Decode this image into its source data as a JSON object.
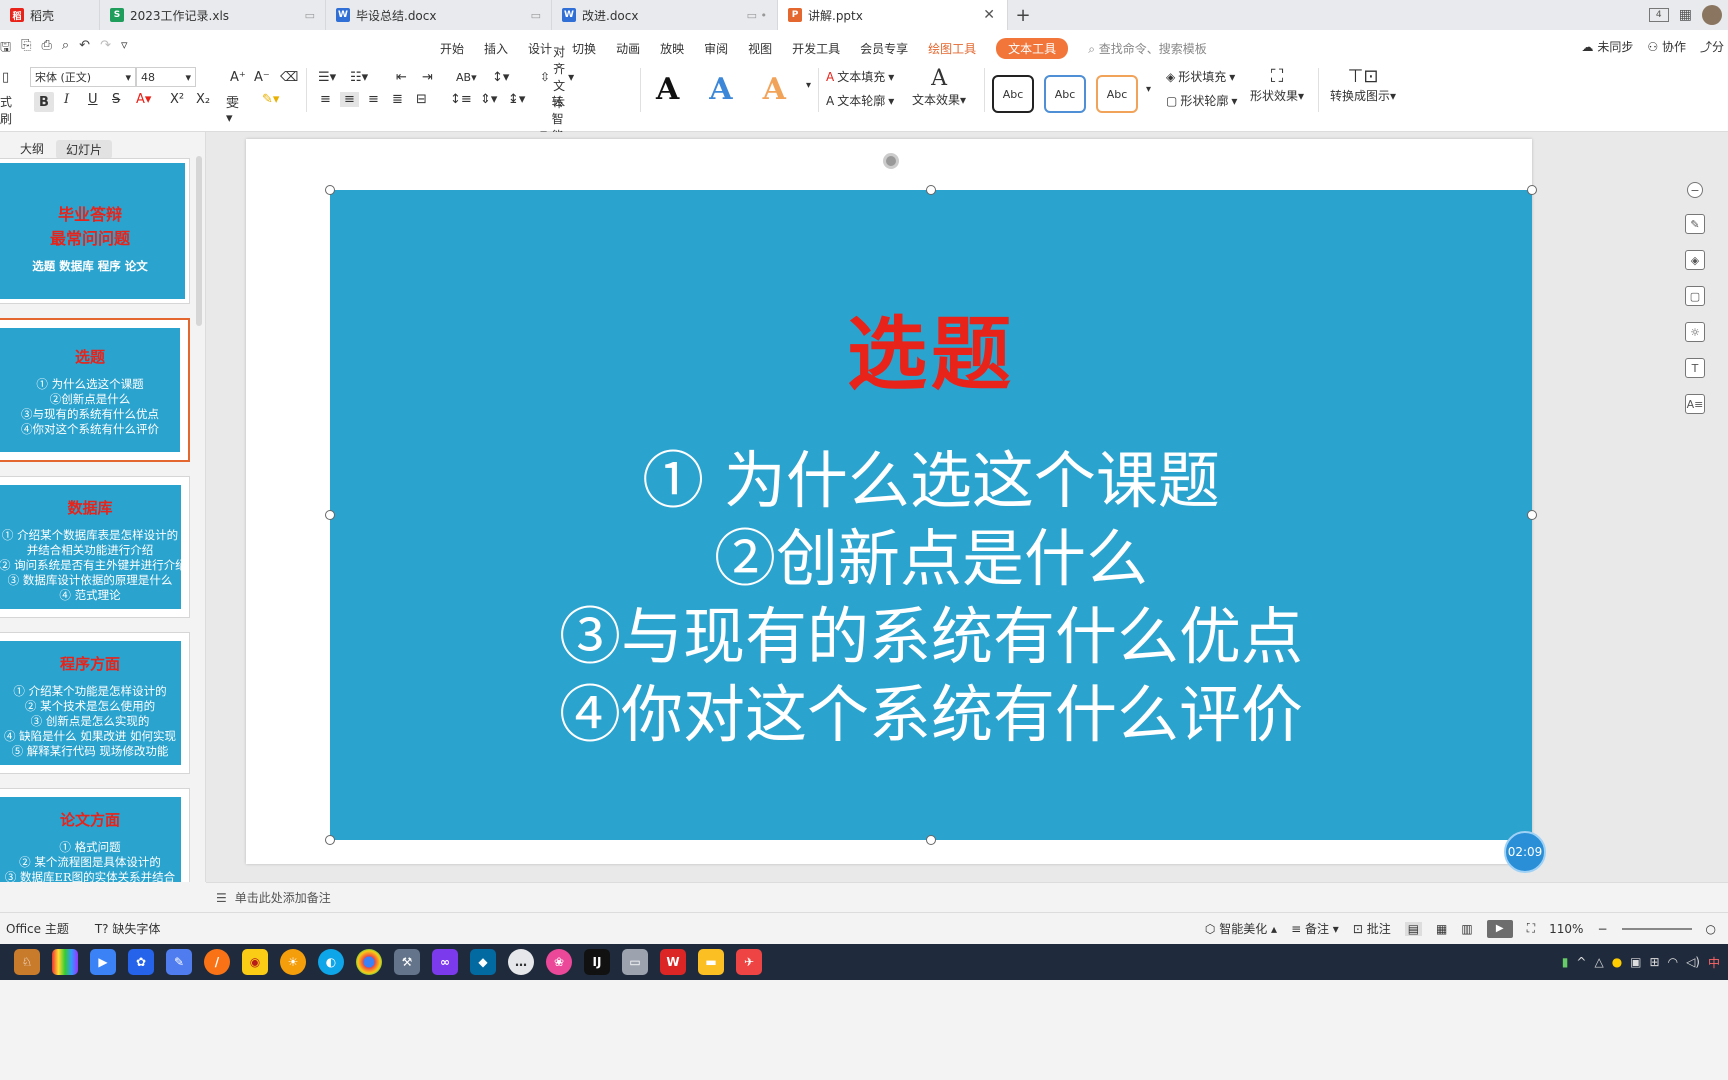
{
  "tabs": [
    {
      "label": "稻壳",
      "icon": "docer-icon",
      "color": "#e8231a"
    },
    {
      "label": "2023工作记录.xls",
      "icon": "spreadsheet-icon",
      "color": "#1e9e5a"
    },
    {
      "label": "毕设总结.docx",
      "icon": "word-doc-icon",
      "color": "#2f6fd6"
    },
    {
      "label": "改进.docx",
      "icon": "word-doc-icon",
      "color": "#2f6fd6"
    },
    {
      "label": "讲解.pptx",
      "icon": "ppt-icon",
      "color": "#e3672f"
    }
  ],
  "window": {
    "tab_badge": "4"
  },
  "menu": {
    "items": [
      "开始",
      "插入",
      "设计",
      "切换",
      "动画",
      "放映",
      "审阅",
      "视图",
      "开发工具",
      "会员专享"
    ],
    "drawing_tools": "绘图工具",
    "text_tools": "文本工具",
    "search_placeholder": "查找命令、搜索模板",
    "sync": "未同步",
    "collab": "协作",
    "share": "分"
  },
  "ribbon": {
    "left_cut": "式刷",
    "font_name": "宋体 (正文)",
    "font_size": "48",
    "align_text": "对齐文本",
    "smart_shape": "转智能图形",
    "text_fill": "文本填充",
    "text_outline": "文本轮廓",
    "text_effect": "文本效果",
    "abc": "Abc",
    "shape_fill": "形状填充",
    "shape_outline": "形状轮廓",
    "shape_effect": "形状效果",
    "convert_diagram": "转换成图示"
  },
  "leftpanel": {
    "tab_outline": "大纲",
    "tab_slides": "幻灯片",
    "add": "+"
  },
  "thumbnails": [
    {
      "title": "毕业答辩",
      "title2": "最常问问题",
      "lines": [
        "选题 数据库 程序 论文"
      ]
    },
    {
      "title": "选题",
      "lines": [
        "① 为什么选这个课题",
        "②创新点是什么",
        "③与现有的系统有什么优点",
        "④你对这个系统有什么评价"
      ]
    },
    {
      "title": "数据库",
      "lines": [
        "① 介绍某个数据库表是怎样设计的",
        "并结合相关功能进行介绍",
        "② 询问系统是否有主外键并进行介绍",
        "③ 数据库设计依据的原理是什么",
        "④ 范式理论"
      ]
    },
    {
      "title": "程序方面",
      "lines": [
        "① 介绍某个功能是怎样设计的",
        "② 某个技术是怎么使用的",
        "③ 创新点是怎么实现的",
        "④ 缺陷是什么 如果改进 如何实现",
        "⑤ 解释某行代码 现场修改功能"
      ]
    },
    {
      "title": "论文方面",
      "lines": [
        "① 格式问题",
        "② 某个流程图是具体设计的",
        "③ 数据库ER图的实体关系并结合"
      ]
    }
  ],
  "slide": {
    "title": "选题",
    "lines": [
      "① 为什么选这个课题",
      "②创新点是什么",
      "③与现有的系统有什么优点",
      "④你对这个系统有什么评价"
    ],
    "bg_color": "#2ba3cf",
    "title_color": "#e8231a"
  },
  "timer": "02:09",
  "notes_placeholder": "单击此处添加备注",
  "status": {
    "theme": "Office 主题",
    "missing_font": "缺失字体",
    "smart_beautify": "智能美化",
    "notes": "备注",
    "comments": "批注",
    "zoom": "110%"
  }
}
